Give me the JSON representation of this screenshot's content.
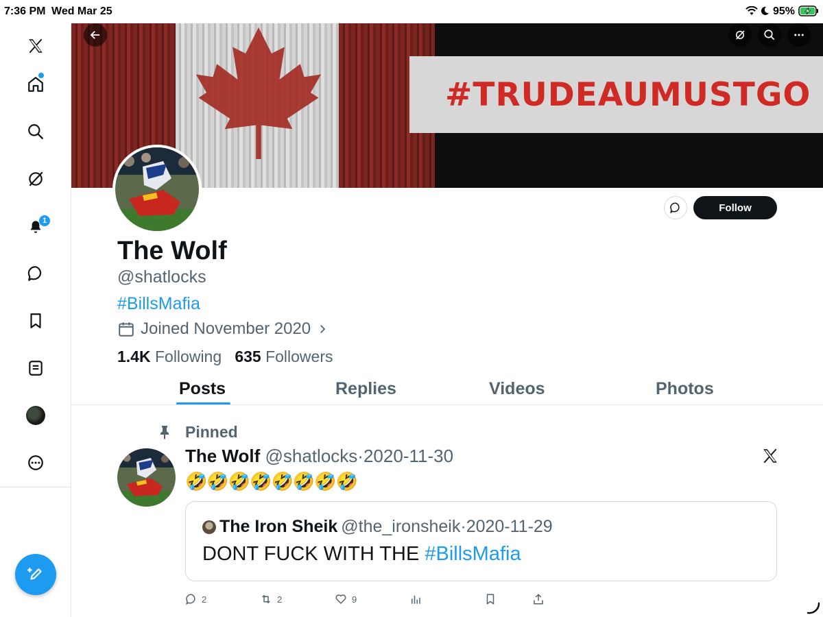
{
  "status_bar": {
    "time": "7:36 PM",
    "date": "Wed Mar 25",
    "battery": "95%"
  },
  "sidebar": {
    "items": [
      {
        "name": "x-logo-icon"
      },
      {
        "name": "home-icon",
        "has_dot": true
      },
      {
        "name": "search-icon"
      },
      {
        "name": "grok-icon"
      },
      {
        "name": "notifications-bell-icon",
        "badge": "1"
      },
      {
        "name": "messages-icon"
      },
      {
        "name": "bookmarks-icon"
      },
      {
        "name": "lists-icon"
      },
      {
        "name": "profile-avatar"
      },
      {
        "name": "more-icon"
      }
    ],
    "compose_icon": "compose-icon",
    "accent": "#1d9bf0"
  },
  "banner": {
    "text": "#TRUDEAUMUSTGO",
    "text_color": "#d02a24"
  },
  "profile": {
    "name": "The Wolf",
    "handle": "@shatlocks",
    "bio": "#BillsMafia",
    "joined": "Joined November 2020",
    "following_count": "1.4K",
    "following_label": "Following",
    "followers_count": "635",
    "followers_label": "Followers",
    "follow_label": "Follow"
  },
  "tabs": [
    {
      "label": "Posts",
      "active": true
    },
    {
      "label": "Replies"
    },
    {
      "label": "Videos"
    },
    {
      "label": "Photos"
    }
  ],
  "post": {
    "pinned_label": "Pinned",
    "author": "The Wolf",
    "handle": "@shatlocks",
    "sep": "·",
    "date": "2020-11-30",
    "content": "🤣🤣🤣🤣🤣🤣🤣🤣",
    "quote": {
      "author": "The Iron Sheik",
      "handle": "@the_ironsheik",
      "sep": "·",
      "date": "2020-11-29",
      "text": "DONT FUCK WITH THE ",
      "hashtag": "#BillsMafia"
    },
    "actions": {
      "replies": "2",
      "reposts": "2",
      "likes": "9"
    }
  }
}
